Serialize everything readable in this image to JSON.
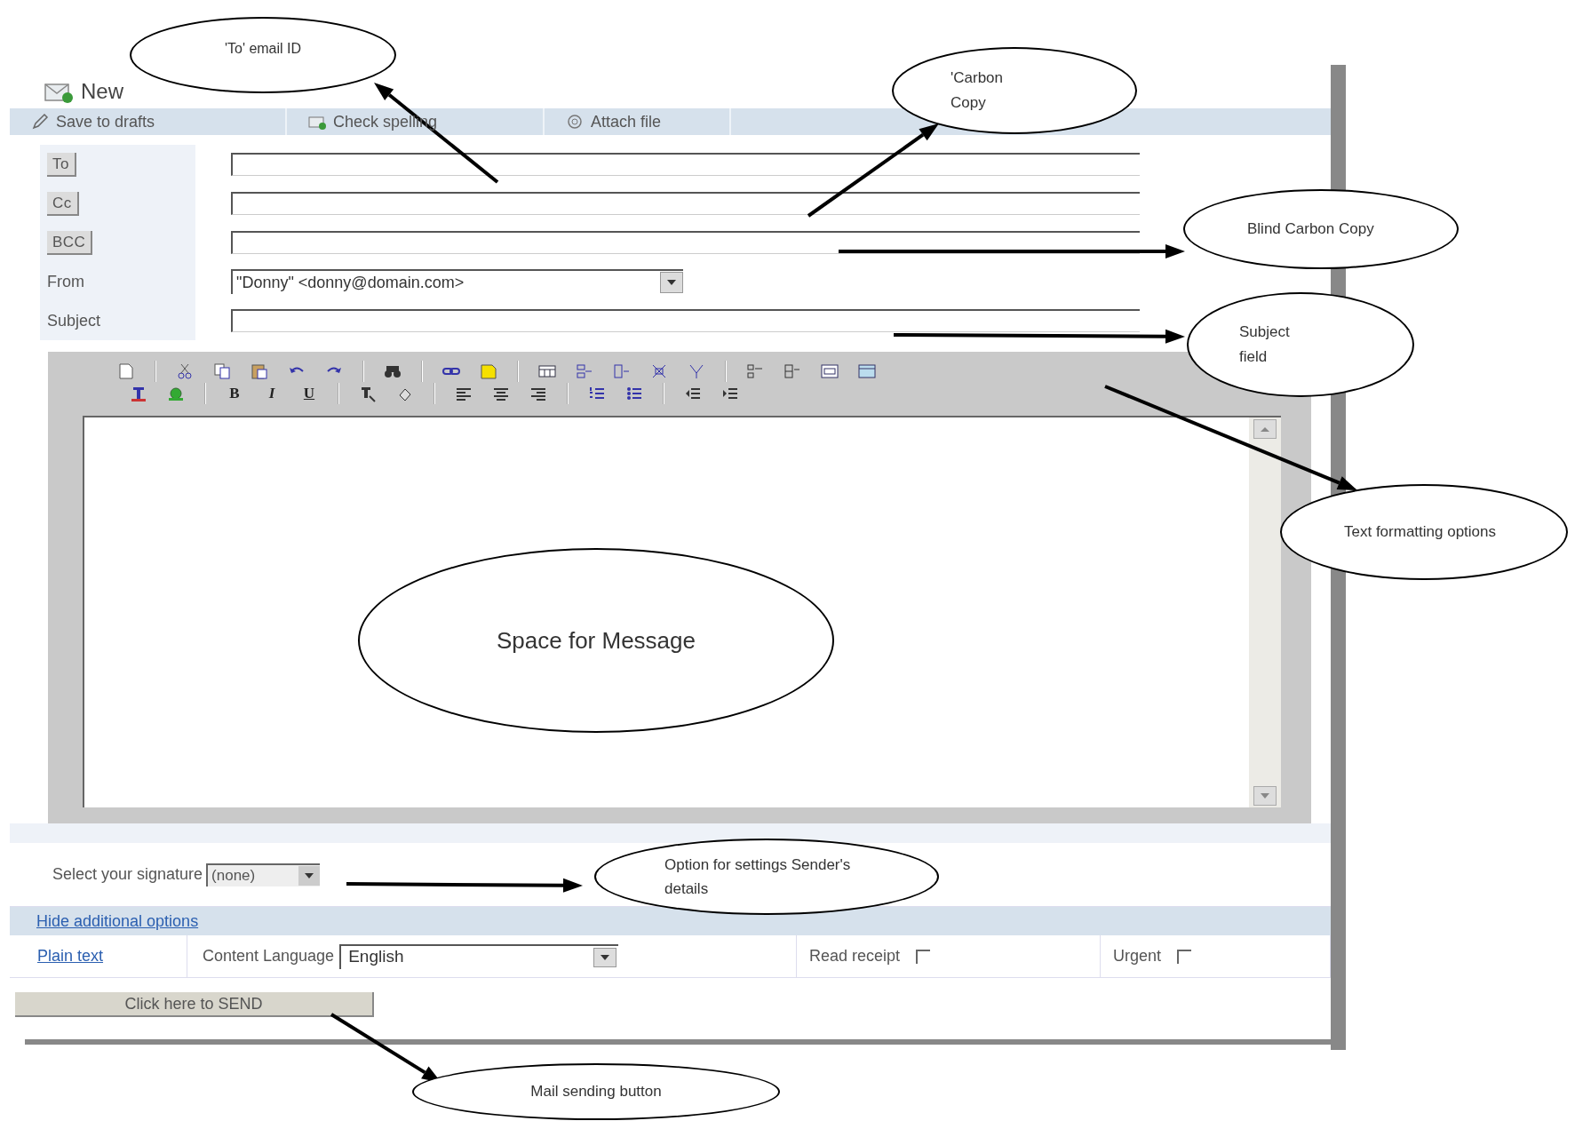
{
  "window": {
    "title": "New"
  },
  "toolbar": [
    {
      "label": "Save to drafts"
    },
    {
      "label": "Check spelling"
    },
    {
      "label": "Attach file"
    }
  ],
  "address_fields": [
    {
      "kind": "button",
      "label": "To"
    },
    {
      "kind": "button",
      "label": "Cc"
    },
    {
      "kind": "button",
      "label": "BCC"
    },
    {
      "kind": "select",
      "label": "From",
      "value": "\"Donny\" <donny@domain.com>"
    },
    {
      "kind": "text",
      "label": "Subject"
    }
  ],
  "editor_toolbar": {
    "format_buttons": [
      "B",
      "I",
      "U"
    ]
  },
  "signature": {
    "label": "Select your signature",
    "value": "(none)"
  },
  "additional_options_link": "Hide additional options",
  "options": {
    "plain_text_link": "Plain text",
    "language_label": "Content Language",
    "language": "English",
    "read_receipt": {
      "label": "Read receipt",
      "checked": false
    },
    "urgent": {
      "label": "Urgent",
      "checked": false
    }
  },
  "send_button": "Click here to SEND",
  "annotations": [
    {
      "text": "'To' email ID"
    },
    {
      "text": "'Carbon Copy"
    },
    {
      "text": "Blind Carbon Copy"
    },
    {
      "text": "Subject field"
    },
    {
      "text": "Text formatting options"
    },
    {
      "text": "Space for Message"
    },
    {
      "text": "Option for settings Sender's details"
    },
    {
      "text": "Mail sending button"
    }
  ]
}
